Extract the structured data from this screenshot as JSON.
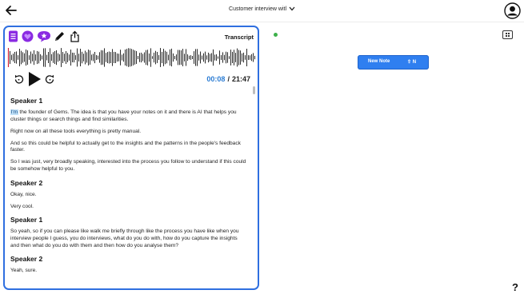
{
  "header": {
    "back_icon": "arrow-left-icon",
    "title": "Customer interview witl",
    "dropdown_icon": "chevron-down-icon",
    "profile_icon": "user-circle-icon"
  },
  "toolbar": {
    "icons": [
      "notes-icon",
      "heart-icon",
      "star-badge-icon",
      "pen-icon",
      "share-icon"
    ],
    "transcript_label": "Transcript"
  },
  "player": {
    "current_time": "00:08",
    "separator": "/",
    "total_time": "21:47",
    "rewind_icon": "rewind-icon",
    "play_icon": "play-icon",
    "forward_icon": "forward-icon",
    "progress": 0.006
  },
  "transcript": {
    "blocks": [
      {
        "speaker": "Speaker 1",
        "paragraphs": [
          "I'm the founder of Gems. The idea is that you have your notes on it and there is AI that helps you cluster things or search things and find similarities.",
          "Right now on all these tools everything is pretty manual.",
          "And so this could be helpful to actually get to the insights and the patterns in the people's feedback faster.",
          "So I was just, very broadly speaking, interested into the process you follow to understand if this could be somehow helpful to you."
        ]
      },
      {
        "speaker": "Speaker 2",
        "paragraphs": [
          "Okay, nice.",
          "Very cool."
        ]
      },
      {
        "speaker": "Speaker 1",
        "paragraphs": [
          "So yeah, so if you can please like walk me briefly through like the process you have like when you interview people I guess, you do interviews, what do you do with, how do you capture the insights and then what do you do with them and then how do you analyse them?"
        ]
      },
      {
        "speaker": "Speaker 2",
        "paragraphs": [
          "Yeah, sure."
        ]
      }
    ],
    "highlighted_word": "I'm",
    "first_para_rest": " the founder of Gems. The idea is that you have your notes on it and there is AI that helps you cluster things or search things and find similarities."
  },
  "right_panel": {
    "status_color": "#3db04a",
    "grid_icon": "grid-view-icon",
    "new_note_label": "New Note",
    "new_note_shortcut": "⇧ N",
    "help_label": "?"
  },
  "colors": {
    "accent": "#2f6fe0",
    "button_blue": "#2f7ff0",
    "purple": "#8a2be2",
    "time_blue": "#2b7cd3"
  }
}
